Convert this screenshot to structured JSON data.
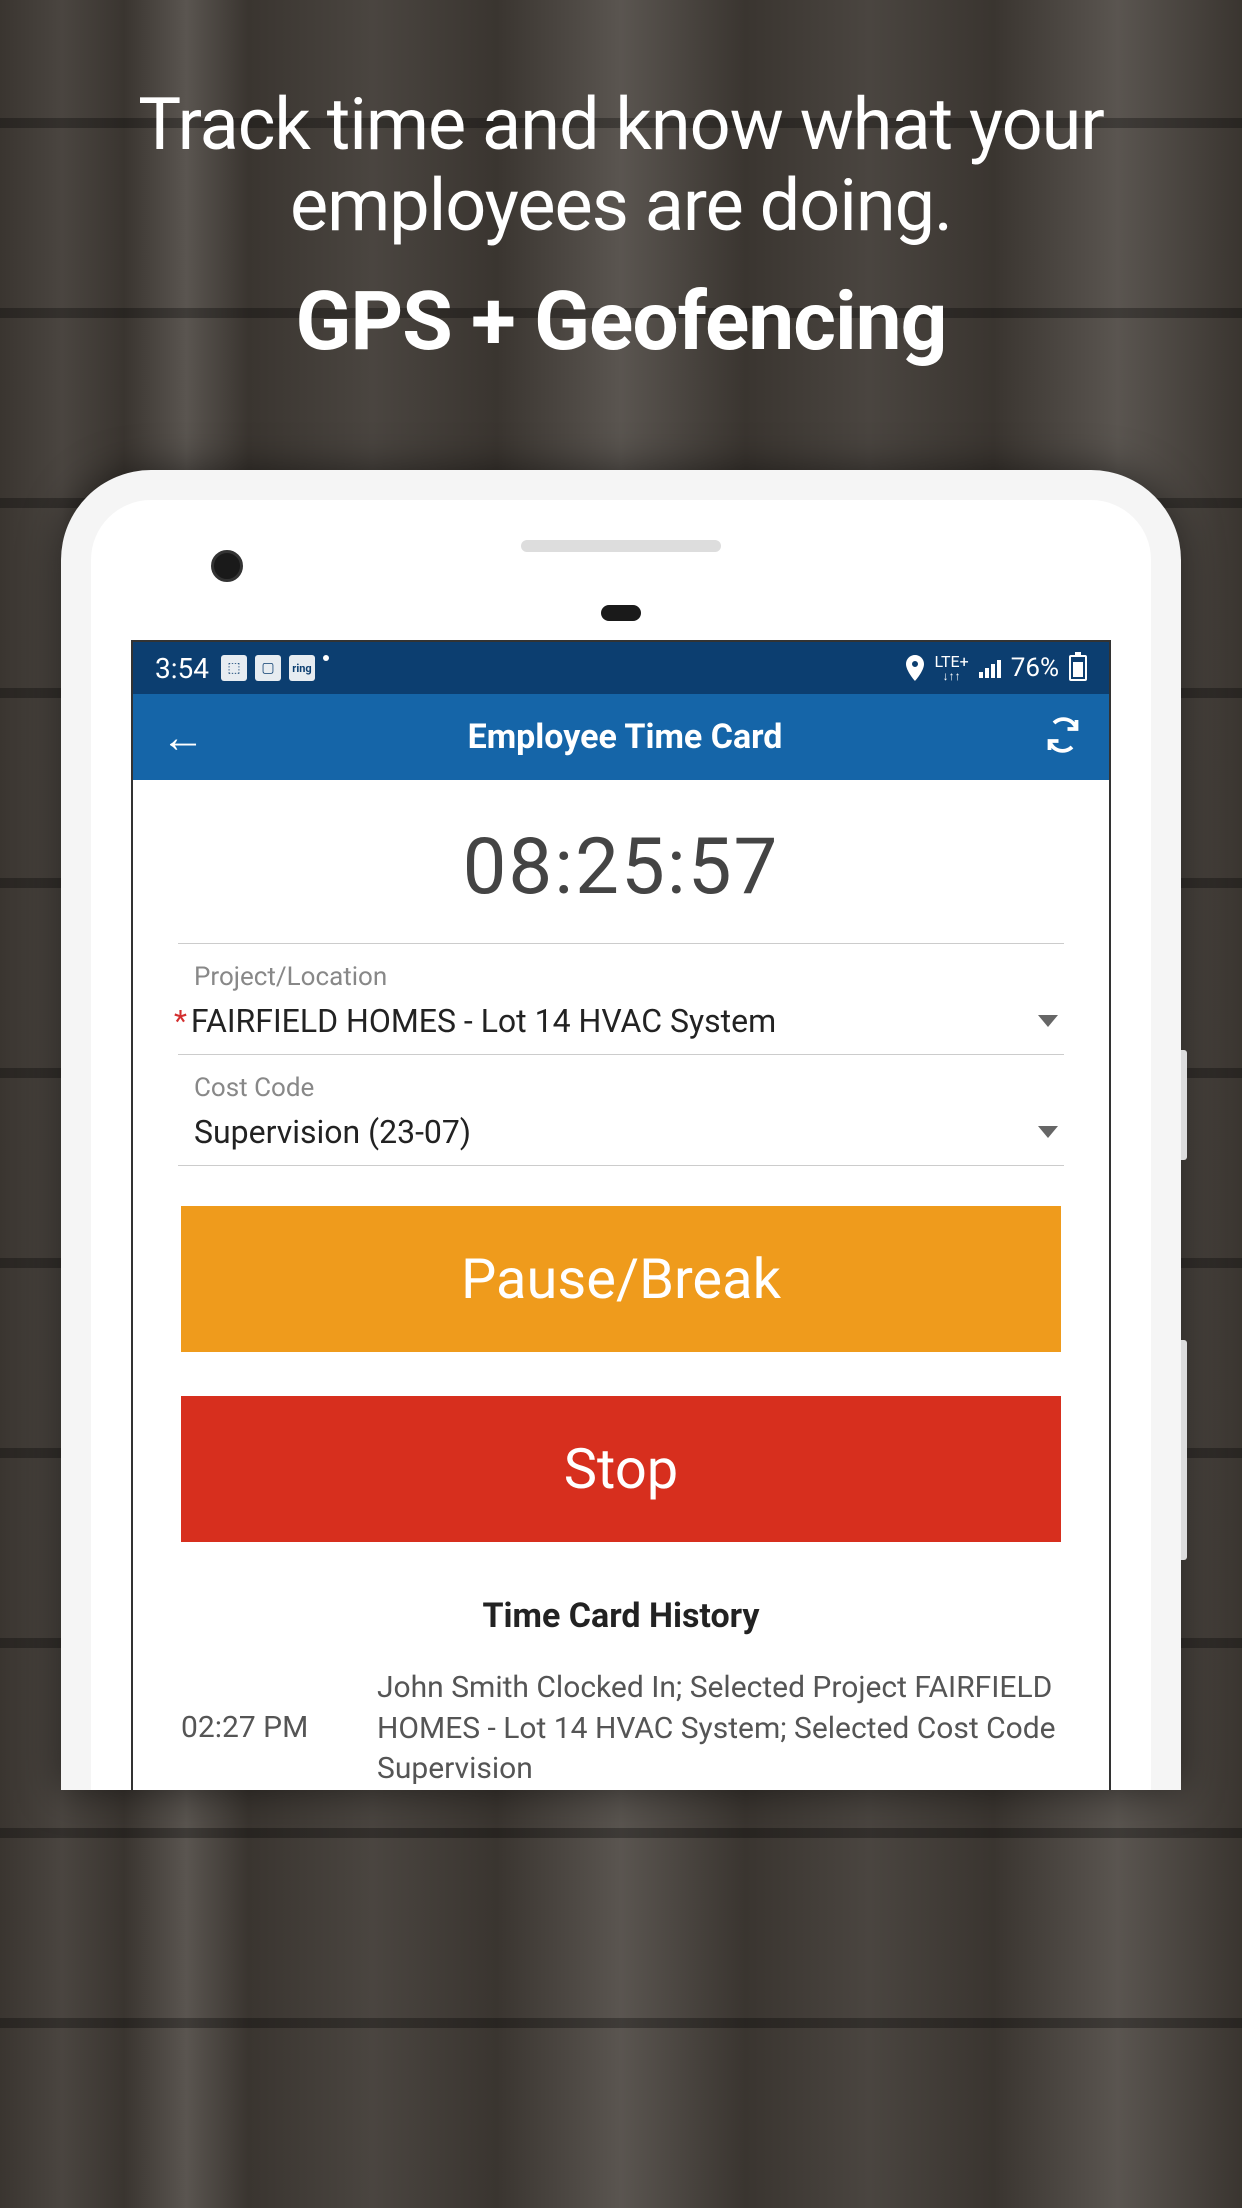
{
  "marketing": {
    "line1": "Track time and know what your employees are doing.",
    "line2": "GPS + Geofencing"
  },
  "status_bar": {
    "time": "3:54",
    "network_type": "LTE+",
    "battery_percent": "76%",
    "icons": [
      "notification",
      "gallery",
      "ring"
    ]
  },
  "header": {
    "title": "Employee Time Card"
  },
  "timer": {
    "elapsed": "08:25:57"
  },
  "fields": {
    "project": {
      "label": "Project/Location",
      "value": "FAIRFIELD HOMES - Lot 14 HVAC System",
      "required": true
    },
    "cost_code": {
      "label": "Cost Code",
      "value": "Supervision (23-07)",
      "required": false
    }
  },
  "buttons": {
    "pause": "Pause/Break",
    "stop": "Stop"
  },
  "history": {
    "title": "Time Card History",
    "entries": [
      {
        "time": "02:27 PM",
        "description": "John Smith Clocked In; Selected Project FAIRFIELD HOMES - Lot 14 HVAC System; Selected Cost Code Supervision"
      }
    ]
  },
  "colors": {
    "status_bar": "#0c3e70",
    "header": "#1565a8",
    "pause_button": "#ef9b1c",
    "stop_button": "#d72f1e",
    "required": "#d32f2f"
  }
}
